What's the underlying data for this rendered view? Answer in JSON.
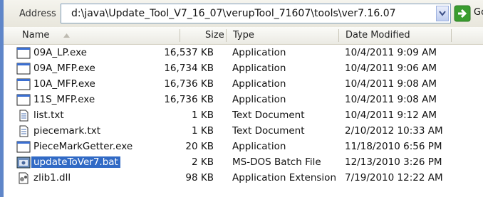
{
  "address": {
    "label": "Address",
    "path": "d:\\java\\Update_Tool_V7_16_07\\verupTool_71607\\tools\\ver7.16.07",
    "go_label": "Go"
  },
  "columns": {
    "name": "Name",
    "size": "Size",
    "type": "Type",
    "date": "Date Modified"
  },
  "sort": {
    "column": "Name",
    "direction": "ascending"
  },
  "files": [
    {
      "name": "09A_LP.exe",
      "size": "16,537 KB",
      "type": "Application",
      "date": "10/4/2011 9:09 AM",
      "icon": "exe-icon"
    },
    {
      "name": "09A_MFP.exe",
      "size": "16,734 KB",
      "type": "Application",
      "date": "10/4/2011 9:06 AM",
      "icon": "exe-icon"
    },
    {
      "name": "10A_MFP.exe",
      "size": "16,736 KB",
      "type": "Application",
      "date": "10/4/2011 9:08 AM",
      "icon": "exe-icon"
    },
    {
      "name": "11S_MFP.exe",
      "size": "16,736 KB",
      "type": "Application",
      "date": "10/4/2011 9:08 AM",
      "icon": "exe-icon"
    },
    {
      "name": "list.txt",
      "size": "1 KB",
      "type": "Text Document",
      "date": "10/4/2011 9:12 AM",
      "icon": "text-file-icon"
    },
    {
      "name": "piecemark.txt",
      "size": "1 KB",
      "type": "Text Document",
      "date": "2/10/2012 10:33 AM",
      "icon": "text-file-icon"
    },
    {
      "name": "PieceMarkGetter.exe",
      "size": "20 KB",
      "type": "Application",
      "date": "11/18/2010 6:56 PM",
      "icon": "exe-icon"
    },
    {
      "name": "updateToVer7.bat",
      "size": "2 KB",
      "type": "MS-DOS Batch File",
      "date": "12/13/2010 3:26 PM",
      "icon": "batch-file-icon",
      "selected": true
    },
    {
      "name": "zlib1.dll",
      "size": "98 KB",
      "type": "Application Extension",
      "date": "7/19/2010 12:22 AM",
      "icon": "dll-icon"
    }
  ],
  "colors": {
    "selection": "#316ac5",
    "go_green": "#3a9d2f",
    "window_frame": "#5f86c9"
  }
}
